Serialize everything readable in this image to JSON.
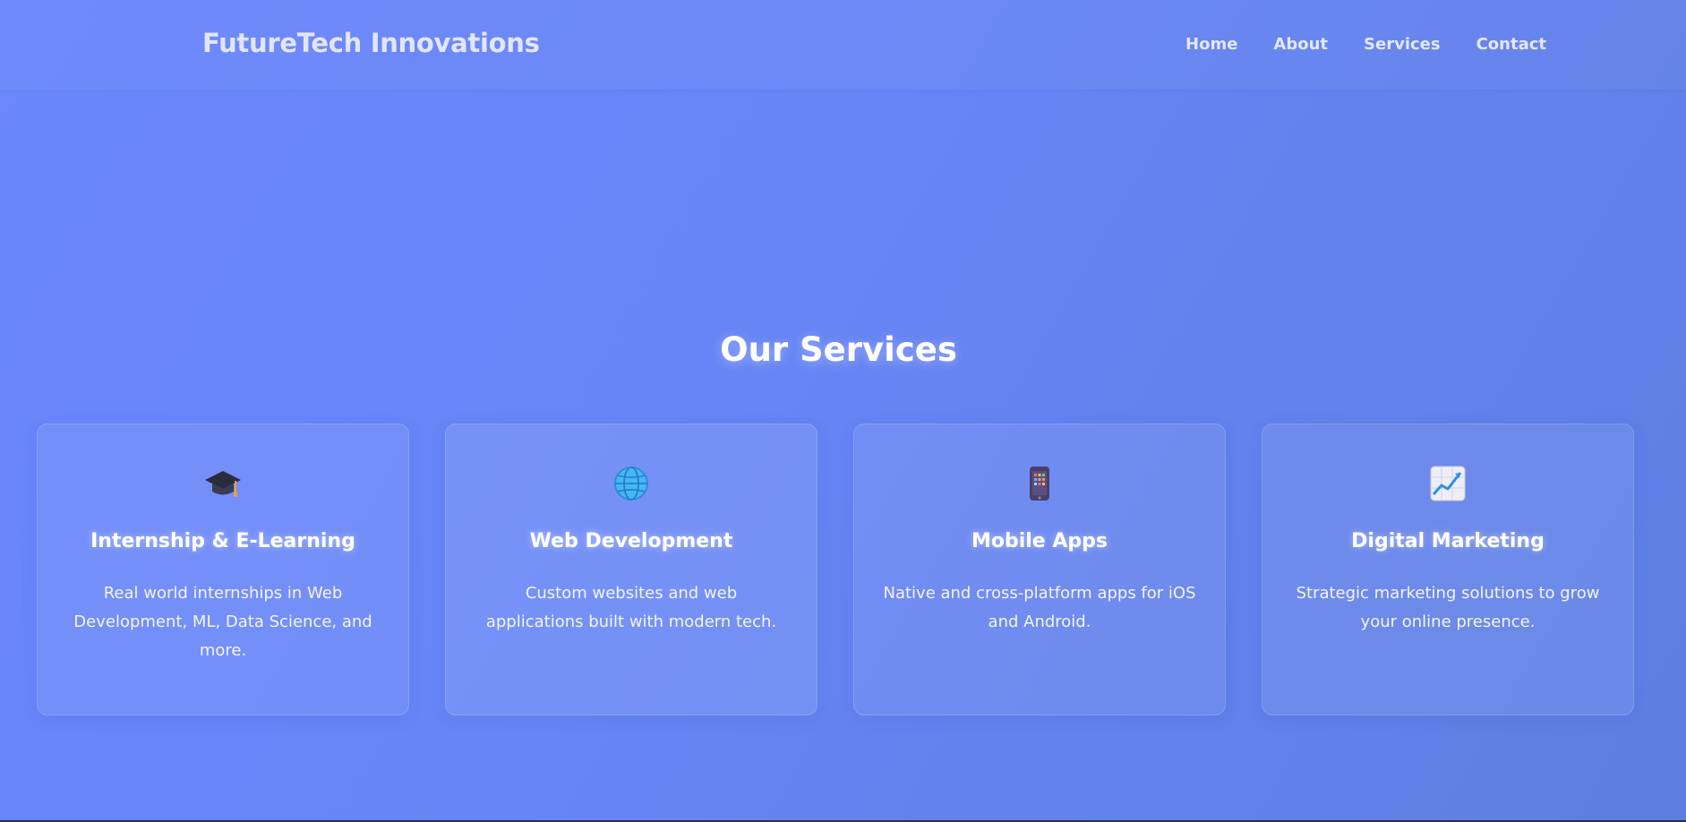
{
  "header": {
    "brand": "FutureTech Innovations",
    "nav": [
      {
        "label": "Home"
      },
      {
        "label": "About"
      },
      {
        "label": "Services"
      },
      {
        "label": "Contact"
      }
    ]
  },
  "services": {
    "title": "Our Services",
    "cards": [
      {
        "icon": "graduation-cap-icon",
        "title": "Internship & E-Learning",
        "description": "Real world internships in Web Development, ML, Data Science, and more."
      },
      {
        "icon": "globe-icon",
        "title": "Web Development",
        "description": "Custom websites and web applications built with modern tech."
      },
      {
        "icon": "mobile-phone-icon",
        "title": "Mobile Apps",
        "description": "Native and cross-platform apps for iOS and Android."
      },
      {
        "icon": "chart-increasing-icon",
        "title": "Digital Marketing",
        "description": "Strategic marketing solutions to grow your online presence."
      }
    ]
  },
  "colors": {
    "background_start": "#6b87fb",
    "background_end": "#5e7ee2",
    "text": "#ffffff"
  }
}
